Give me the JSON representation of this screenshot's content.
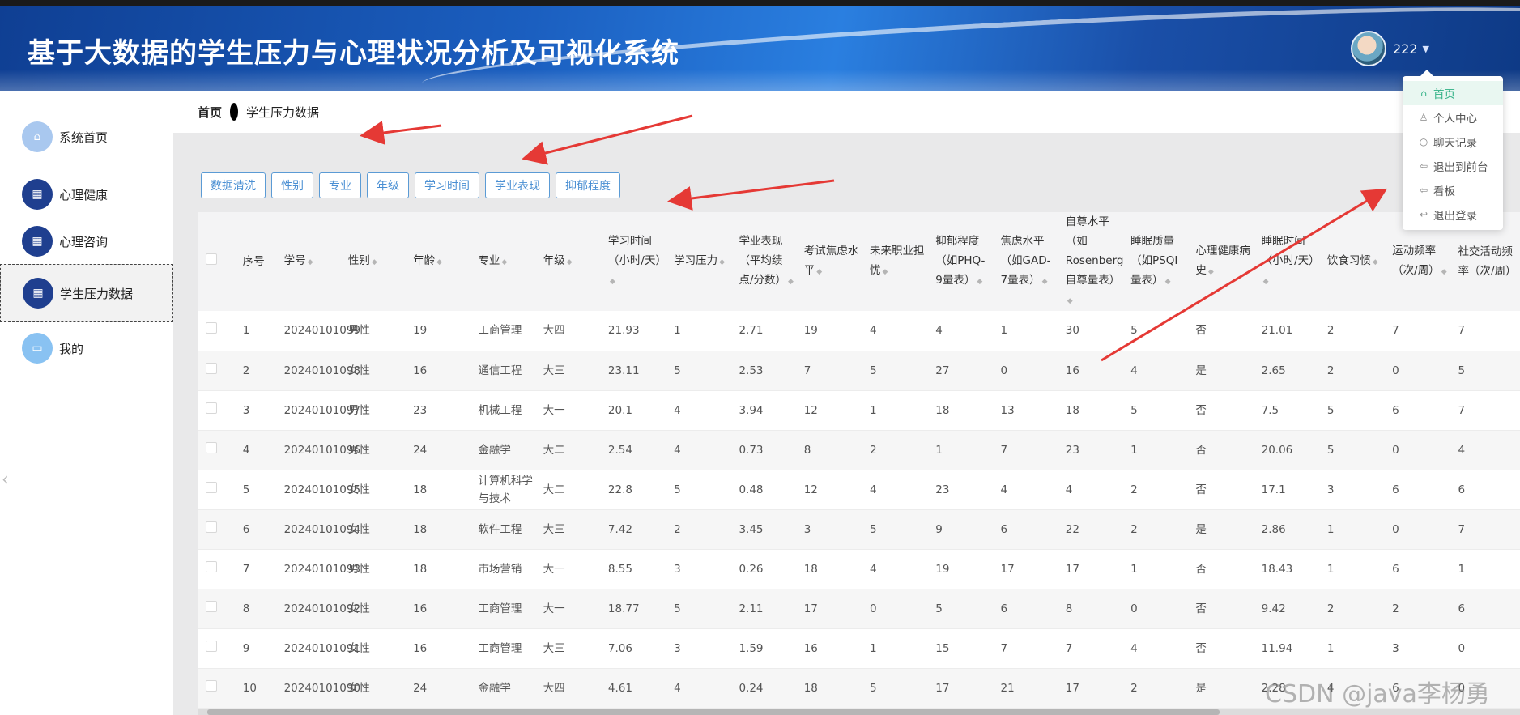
{
  "app": {
    "title": "基于大数据的学生压力与心理状况分析及可视化系统"
  },
  "user": {
    "name": "222"
  },
  "dropdown": [
    {
      "label": "首页",
      "icon": "home-icon",
      "glyph": "⌂"
    },
    {
      "label": "个人中心",
      "icon": "user-icon",
      "glyph": "♙"
    },
    {
      "label": "聊天记录",
      "icon": "chat-icon",
      "glyph": "○"
    },
    {
      "label": "退出到前台",
      "icon": "back-icon",
      "glyph": "⇦"
    },
    {
      "label": "看板",
      "icon": "board-icon",
      "glyph": "⇦"
    },
    {
      "label": "退出登录",
      "icon": "logout-icon",
      "glyph": "↩"
    }
  ],
  "sidebar": {
    "items": [
      {
        "label": "系统首页",
        "icon": "home-icon",
        "glyph": "⌂",
        "style": "light",
        "active": false
      },
      {
        "label": "心理健康",
        "icon": "grid-icon",
        "glyph": "▦",
        "style": "dark",
        "active": false
      },
      {
        "label": "心理咨询",
        "icon": "grid-icon",
        "glyph": "▦",
        "style": "dark",
        "active": false
      },
      {
        "label": "学生压力数据",
        "icon": "grid-icon",
        "glyph": "▦",
        "style": "dark",
        "active": true
      },
      {
        "label": "我的",
        "icon": "profile-icon",
        "glyph": "▭",
        "style": "sky",
        "active": false
      }
    ]
  },
  "breadcrumb": {
    "home": "首页",
    "current": "学生压力数据"
  },
  "filter_buttons": [
    "数据清洗",
    "性别",
    "专业",
    "年级",
    "学习时间",
    "学业表现",
    "抑郁程度"
  ],
  "table": {
    "columns": [
      {
        "label": "",
        "sortable": false
      },
      {
        "label": "序号",
        "sortable": false
      },
      {
        "label": "学号",
        "sortable": true
      },
      {
        "label": "性别",
        "sortable": true
      },
      {
        "label": "年龄",
        "sortable": true
      },
      {
        "label": "专业",
        "sortable": true
      },
      {
        "label": "年级",
        "sortable": true
      },
      {
        "label": "学习时间（小时/天）",
        "sortable": true
      },
      {
        "label": "学习压力",
        "sortable": true
      },
      {
        "label": "学业表现（平均绩点/分数）",
        "sortable": true
      },
      {
        "label": "考试焦虑水平",
        "sortable": true
      },
      {
        "label": "未来职业担忧",
        "sortable": true
      },
      {
        "label": "抑郁程度（如PHQ-9量表）",
        "sortable": true
      },
      {
        "label": "焦虑水平（如GAD-7量表）",
        "sortable": true
      },
      {
        "label": "自尊水平（如Rosenberg自尊量表）",
        "sortable": true
      },
      {
        "label": "睡眠质量（如PSQI量表）",
        "sortable": true
      },
      {
        "label": "心理健康病史",
        "sortable": true
      },
      {
        "label": "睡眠时间（小时/天）",
        "sortable": true
      },
      {
        "label": "饮食习惯",
        "sortable": true
      },
      {
        "label": "运动频率（次/周）",
        "sortable": true
      },
      {
        "label": "社交活动频率（次/周）",
        "sortable": false
      }
    ],
    "rows": [
      [
        "1",
        "20240101099",
        "男性",
        "19",
        "工商管理",
        "大四",
        "21.93",
        "1",
        "2.71",
        "19",
        "4",
        "4",
        "1",
        "30",
        "5",
        "否",
        "21.01",
        "2",
        "7",
        "7"
      ],
      [
        "2",
        "20240101098",
        "女性",
        "16",
        "通信工程",
        "大三",
        "23.11",
        "5",
        "2.53",
        "7",
        "5",
        "27",
        "0",
        "16",
        "4",
        "是",
        "2.65",
        "2",
        "0",
        "5"
      ],
      [
        "3",
        "20240101097",
        "男性",
        "23",
        "机械工程",
        "大一",
        "20.1",
        "4",
        "3.94",
        "12",
        "1",
        "18",
        "13",
        "18",
        "5",
        "否",
        "7.5",
        "5",
        "6",
        "7"
      ],
      [
        "4",
        "20240101096",
        "男性",
        "24",
        "金融学",
        "大二",
        "2.54",
        "4",
        "0.73",
        "8",
        "2",
        "1",
        "7",
        "23",
        "1",
        "否",
        "20.06",
        "5",
        "0",
        "4"
      ],
      [
        "5",
        "20240101095",
        "女性",
        "18",
        "计算机科学与技术",
        "大二",
        "22.8",
        "5",
        "0.48",
        "12",
        "4",
        "23",
        "4",
        "4",
        "2",
        "否",
        "17.1",
        "3",
        "6",
        "6"
      ],
      [
        "6",
        "20240101094",
        "女性",
        "18",
        "软件工程",
        "大三",
        "7.42",
        "2",
        "3.45",
        "3",
        "5",
        "9",
        "6",
        "22",
        "2",
        "是",
        "2.86",
        "1",
        "0",
        "7"
      ],
      [
        "7",
        "20240101093",
        "男性",
        "18",
        "市场营销",
        "大一",
        "8.55",
        "3",
        "0.26",
        "18",
        "4",
        "19",
        "17",
        "17",
        "1",
        "否",
        "18.43",
        "1",
        "6",
        "1"
      ],
      [
        "8",
        "20240101092",
        "女性",
        "16",
        "工商管理",
        "大一",
        "18.77",
        "5",
        "2.11",
        "17",
        "0",
        "5",
        "6",
        "8",
        "0",
        "否",
        "9.42",
        "2",
        "2",
        "6"
      ],
      [
        "9",
        "20240101091",
        "女性",
        "16",
        "工商管理",
        "大三",
        "7.06",
        "3",
        "1.59",
        "16",
        "1",
        "15",
        "7",
        "7",
        "4",
        "否",
        "11.94",
        "1",
        "3",
        "0"
      ],
      [
        "10",
        "20240101090",
        "女性",
        "24",
        "金融学",
        "大四",
        "4.61",
        "4",
        "0.24",
        "18",
        "5",
        "17",
        "21",
        "17",
        "2",
        "是",
        "2.28",
        "4",
        "6",
        "0"
      ]
    ]
  },
  "watermark": "CSDN @java李杨勇",
  "colors": {
    "header": "#1b5fc0",
    "accent_button": "#4a8fd3",
    "dropdown_active": "#2fb085",
    "annotation_arrow": "#e53935"
  }
}
